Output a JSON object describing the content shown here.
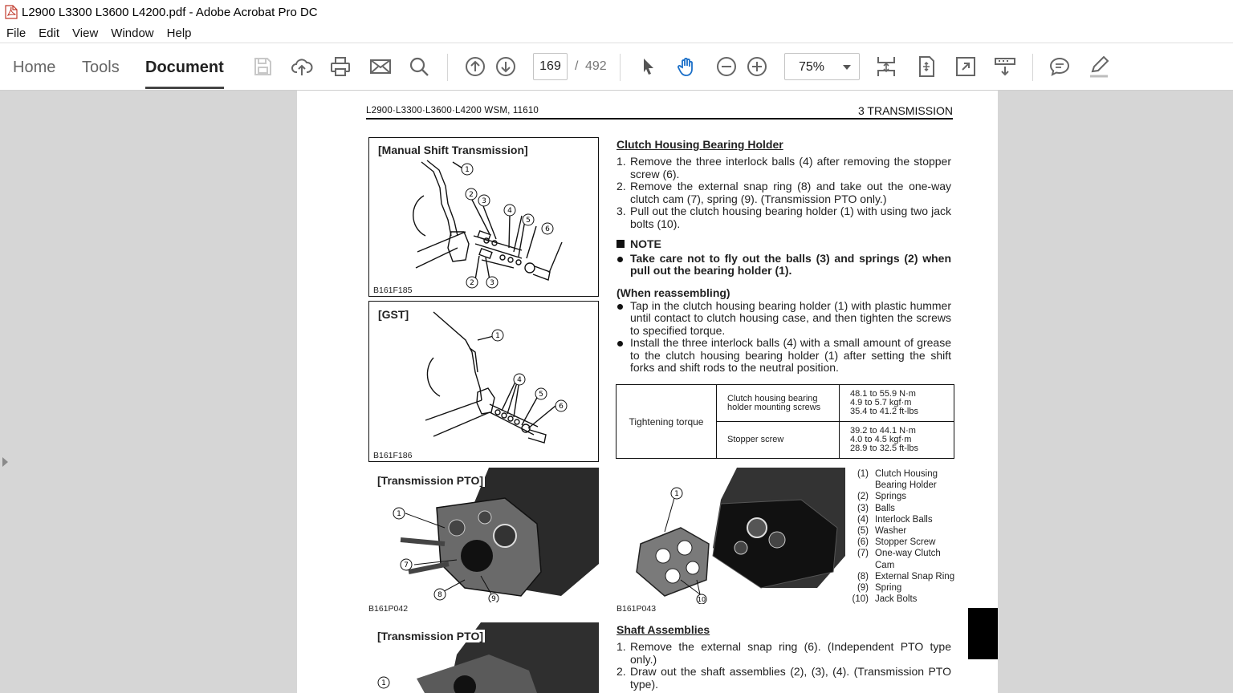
{
  "window": {
    "title": "L2900 L3300 L3600 L4200.pdf - Adobe Acrobat Pro DC",
    "icon": "pdf-file-icon"
  },
  "menu": [
    "File",
    "Edit",
    "View",
    "Window",
    "Help"
  ],
  "tabs": {
    "home": "Home",
    "tools": "Tools",
    "document": "Document",
    "active": "Document"
  },
  "toolbar": {
    "icons": [
      "save-icon",
      "upload-cloud-icon",
      "print-icon",
      "email-icon",
      "search-icon",
      "page-up-icon",
      "page-down-icon",
      "select-cursor-icon",
      "hand-tool-icon",
      "zoom-out-icon",
      "zoom-in-icon",
      "scroll-mode-icon",
      "fit-page-icon",
      "full-screen-icon",
      "read-mode-icon",
      "comment-icon",
      "highlight-pen-icon"
    ],
    "page_current": "169",
    "page_separator": "/",
    "page_total": "492",
    "zoom": "75%",
    "accent_color": "#1b6fc8"
  },
  "document": {
    "header_left": "L2900·L3300·L3600·L4200  WSM, 11610",
    "header_right": "3  TRANSMISSION",
    "figures": {
      "fig1_title": "[Manual Shift Transmission]",
      "fig1_code": "B161F185",
      "fig2_title": "[GST]",
      "fig2_code": "B161F186",
      "fig3_title": "[Transmission PTO]",
      "fig3_code": "B161P042",
      "fig4_code": "B161P043",
      "fig5_title": "[Transmission PTO]"
    },
    "section1": {
      "title": "Clutch Housing Bearing Holder",
      "steps": [
        {
          "num": "1.",
          "text": "Remove the three interlock balls (4) after removing the stopper screw (6)."
        },
        {
          "num": "2.",
          "text": "Remove the external snap ring (8) and take out the one-way clutch cam (7), spring (9).  (Transmission PTO only.)"
        },
        {
          "num": "3.",
          "text": "Pull out the clutch housing bearing holder (1) with using two jack bolts (10)."
        }
      ],
      "note_label": "NOTE",
      "note_text": "Take care not to fly out the balls (3) and springs (2) when pull out the bearing holder (1).",
      "reassembling_label": "(When reassembling)",
      "reassembling": [
        "Tap in the clutch housing bearing holder (1) with plastic hummer until contact to clutch housing case, and then tighten the screws to specified torque.",
        "Install the three interlock balls (4) with a small amount of grease to the clutch housing bearing holder (1) after setting the shift forks and shift rods to the neutral position."
      ]
    },
    "torque_table": {
      "label": "Tightening torque",
      "rows": [
        {
          "item_line1": "Clutch housing bearing",
          "item_line2": "holder mounting screws",
          "v1": "48.1 to 55.9 N·m",
          "v2": "4.9 to 5.7 kgf·m",
          "v3": "35.4 to 41.2 ft-lbs"
        },
        {
          "item_line1": "Stopper screw",
          "item_line2": "",
          "v1": "39.2 to 44.1 N·m",
          "v2": "4.0 to 4.5 kgf·m",
          "v3": "28.9 to 32.5 ft-lbs"
        }
      ]
    },
    "legend": [
      {
        "n": "(1)",
        "t": "Clutch Housing"
      },
      {
        "n": "",
        "t": "Bearing Holder"
      },
      {
        "n": "(2)",
        "t": "Springs"
      },
      {
        "n": "(3)",
        "t": "Balls"
      },
      {
        "n": "(4)",
        "t": "Interlock Balls"
      },
      {
        "n": "(5)",
        "t": "Washer"
      },
      {
        "n": "(6)",
        "t": "Stopper Screw"
      },
      {
        "n": "(7)",
        "t": "One-way Clutch"
      },
      {
        "n": "",
        "t": "Cam"
      },
      {
        "n": "(8)",
        "t": "External Snap Ring"
      },
      {
        "n": "(9)",
        "t": "Spring"
      },
      {
        "n": "(10)",
        "t": "Jack Bolts"
      }
    ],
    "section2": {
      "title": "Shaft Assemblies",
      "steps": [
        {
          "num": "1.",
          "text": "Remove the external snap ring (6).  (Independent PTO type only.)"
        },
        {
          "num": "2.",
          "text": "Draw out the shaft assemblies (2), (3), (4).  (Transmission PTO type)."
        }
      ]
    },
    "callouts": {
      "fig1": [
        "1",
        "2",
        "3",
        "4",
        "5",
        "6",
        "2",
        "3"
      ],
      "fig2": [
        "1",
        "4",
        "5",
        "6"
      ],
      "fig3": [
        "1",
        "7",
        "8",
        "9"
      ],
      "fig4": [
        "1",
        "10"
      ],
      "fig5": [
        "1"
      ]
    }
  }
}
